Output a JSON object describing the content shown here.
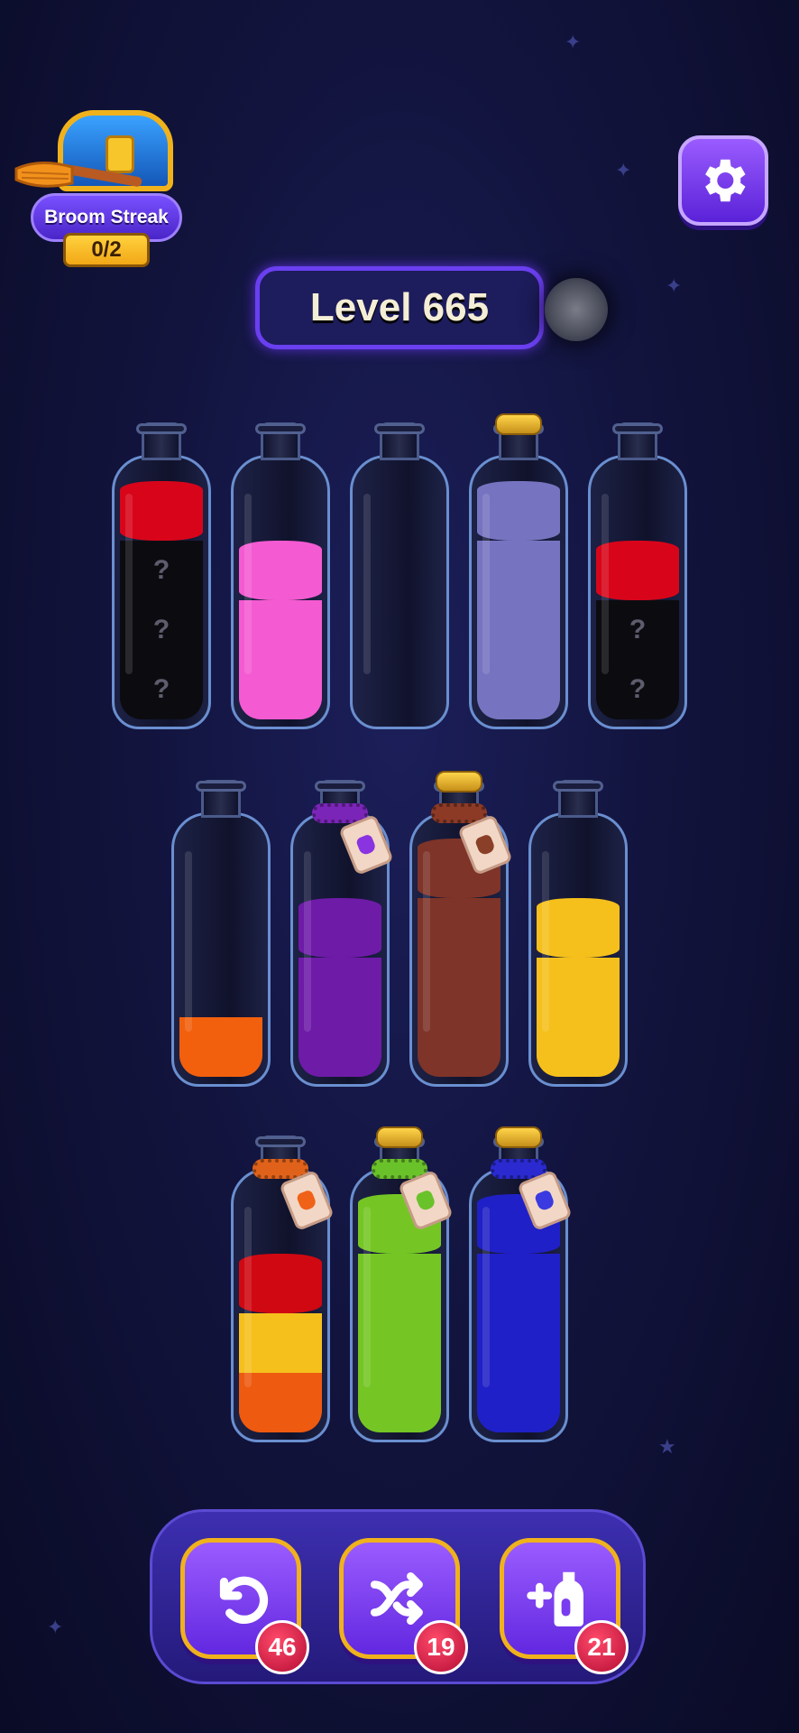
{
  "streak": {
    "title": "Broom Streak",
    "count": "0/2"
  },
  "level": {
    "label": "Level 665"
  },
  "bottles": [
    {
      "layers": [
        {
          "color": "#0c0c10",
          "mystery": true
        },
        {
          "color": "#0c0c10",
          "mystery": true
        },
        {
          "color": "#0c0c10",
          "mystery": true
        },
        {
          "color": "#d8051a",
          "mystery": false
        }
      ],
      "cork": false,
      "tag": null
    },
    {
      "layers": [
        {
          "color": "#f45ad2"
        },
        {
          "color": "#f45ad2"
        },
        {
          "color": "#f45ad2"
        }
      ],
      "cork": false,
      "tag": null
    },
    {
      "layers": [],
      "cork": false,
      "tag": null
    },
    {
      "layers": [
        {
          "color": "#7674c0"
        },
        {
          "color": "#7674c0"
        },
        {
          "color": "#7674c0"
        },
        {
          "color": "#7674c0"
        }
      ],
      "cork": true,
      "tag": null
    },
    {
      "layers": [
        {
          "color": "#0c0c10",
          "mystery": true
        },
        {
          "color": "#0c0c10",
          "mystery": true
        },
        {
          "color": "#d8051a",
          "mystery": false
        }
      ],
      "cork": false,
      "tag": null
    },
    {
      "layers": [
        {
          "color": "#f2600e"
        }
      ],
      "cork": false,
      "tag": null
    },
    {
      "layers": [
        {
          "color": "#6e1ba8"
        },
        {
          "color": "#6e1ba8"
        },
        {
          "color": "#6e1ba8"
        }
      ],
      "cork": false,
      "tag": {
        "rope": "#7a25b8",
        "vial": "#8a33e0"
      }
    },
    {
      "layers": [
        {
          "color": "#7e3428"
        },
        {
          "color": "#7e3428"
        },
        {
          "color": "#7e3428"
        },
        {
          "color": "#7e3428"
        }
      ],
      "cork": true,
      "tag": {
        "rope": "#8c3a26",
        "vial": "#8a4028"
      }
    },
    {
      "layers": [
        {
          "color": "#f5c01c"
        },
        {
          "color": "#f5c01c"
        },
        {
          "color": "#f5c01c"
        }
      ],
      "cork": false,
      "tag": null
    },
    {
      "layers": [
        {
          "color": "#ee5a10"
        },
        {
          "color": "#f5c01c"
        },
        {
          "color": "#d00812"
        }
      ],
      "cork": false,
      "tag": {
        "rope": "#e0621a",
        "vial": "#f06218"
      }
    },
    {
      "layers": [
        {
          "color": "#75c624"
        },
        {
          "color": "#75c624"
        },
        {
          "color": "#75c624"
        },
        {
          "color": "#75c624"
        }
      ],
      "cork": true,
      "tag": {
        "rope": "#6ac22a",
        "vial": "#6ac22a"
      }
    },
    {
      "layers": [
        {
          "color": "#2020c8"
        },
        {
          "color": "#2020c8"
        },
        {
          "color": "#2020c8"
        },
        {
          "color": "#2020c8"
        }
      ],
      "cork": true,
      "tag": {
        "rope": "#2a2ad0",
        "vial": "#3a3ae0"
      }
    }
  ],
  "powerups": {
    "undo_count": "46",
    "shuffle_count": "19",
    "add_bottle_count": "21"
  },
  "mystery_mark": "?"
}
